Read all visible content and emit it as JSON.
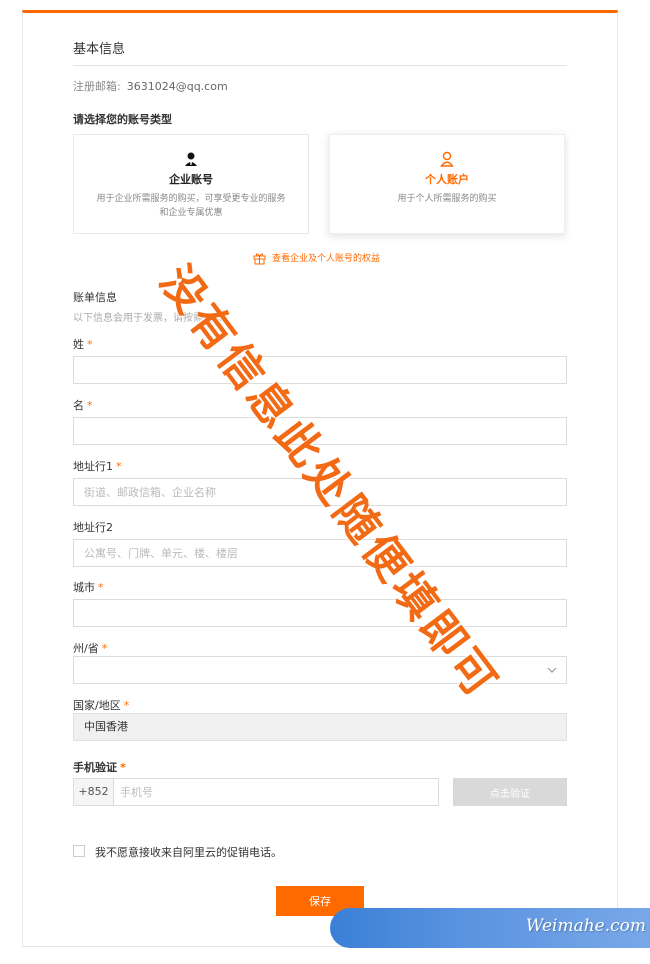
{
  "basic_info": {
    "title": "基本信息",
    "email_label": "注册邮箱:",
    "email_value": "3631024@qq.com"
  },
  "account_type": {
    "prompt": "请选择您的账号类型",
    "cards": [
      {
        "title": "企业账号",
        "desc_line1": "用于企业所需服务的购买，可享受更专业的服务",
        "desc_line2": "和企业专属优惠",
        "icon": "enterprise-user-icon",
        "selected": false
      },
      {
        "title": "个人账户",
        "desc_line1": "用于个人所需服务的购买",
        "desc_line2": "",
        "icon": "personal-user-icon",
        "selected": true
      }
    ],
    "benefits_link": "查看企业及个人账号的权益"
  },
  "billing": {
    "title": "账单信息",
    "subtitle": "以下信息会用于发票，请按需填写。",
    "fields": {
      "last_name": {
        "label": "姓",
        "placeholder": "",
        "value": ""
      },
      "first_name": {
        "label": "名",
        "placeholder": "",
        "value": ""
      },
      "address1": {
        "label": "地址行1",
        "placeholder": "街道、邮政信箱、企业名称",
        "value": ""
      },
      "address2": {
        "label": "地址行2",
        "placeholder": "公寓号、门牌、单元、楼、楼层",
        "value": ""
      },
      "city": {
        "label": "城市",
        "placeholder": "",
        "value": ""
      },
      "province": {
        "label": "州/省",
        "selected": ""
      },
      "country": {
        "label": "国家/地区",
        "value": "中国香港"
      }
    },
    "required_mark": "*"
  },
  "phone": {
    "label": "手机验证",
    "prefix": "+852",
    "placeholder": "手机号",
    "verify_label": "点击验证"
  },
  "opt_out": {
    "label": "我不愿意接收来自阿里云的促销电话。",
    "checked": false
  },
  "save_label": "保存",
  "overlay": {
    "watermark": "没有信息此处随便填即可",
    "brand": "Weimahe.com"
  },
  "colors": {
    "accent": "#ff6a00",
    "disabled_button": "#d9d9d9",
    "banner_blue": "#3a7fd6"
  }
}
